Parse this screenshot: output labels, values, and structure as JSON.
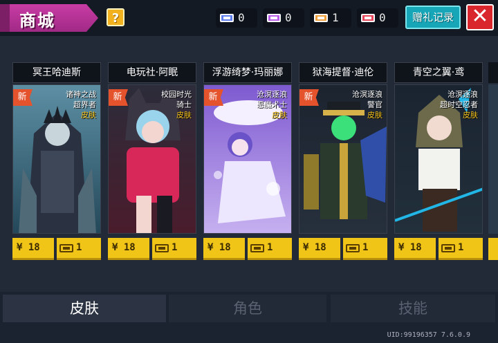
{
  "header": {
    "title": "商城",
    "help_label": "?",
    "currencies": [
      {
        "color": "#5d7cf0",
        "value": "0"
      },
      {
        "color": "#b95de6",
        "value": "0"
      },
      {
        "color": "#f0a03a",
        "value": "1"
      },
      {
        "color": "#e8455a",
        "value": "0"
      }
    ],
    "gift_label": "赠礼记录",
    "close_label": "✕"
  },
  "cards": [
    {
      "name": "冥王哈迪斯",
      "new_label": "新",
      "tags": [
        "诸神之战",
        "超界者"
      ],
      "skin": "皮肤",
      "rmb_price": "¥ 18",
      "ticket_price": "1",
      "art_color": "#3a6f86"
    },
    {
      "name": "电玩社·阿眠",
      "new_label": "新",
      "tags": [
        "校园时光",
        "骑士"
      ],
      "skin": "皮肤",
      "rmb_price": "¥ 18",
      "ticket_price": "1",
      "art_color": "#d0305f"
    },
    {
      "name": "浮游绮梦·玛丽娜",
      "new_label": "新",
      "tags": [
        "沧溟逐浪",
        "恶魔术士"
      ],
      "skin": "皮肤",
      "rmb_price": "¥ 18",
      "ticket_price": "1",
      "art_color": "#8b63d8"
    },
    {
      "name": "狱海提督·迪伦",
      "new_label": "新",
      "tags": [
        "沧溟逐浪",
        "警官"
      ],
      "skin": "皮肤",
      "rmb_price": "¥ 18",
      "ticket_price": "1",
      "art_color": "#7c7d2a"
    },
    {
      "name": "青空之翼·鸢",
      "new_label": "",
      "tags": [
        "沧溟逐浪",
        "超时空忍者"
      ],
      "skin": "皮肤",
      "rmb_price": "¥ 18",
      "ticket_price": "1",
      "art_color": "#2b8ea8"
    }
  ],
  "tabs": [
    "皮肤",
    "角色",
    "技能"
  ],
  "footer": {
    "uid_text": "UID:99196357 7.6.0.9"
  }
}
